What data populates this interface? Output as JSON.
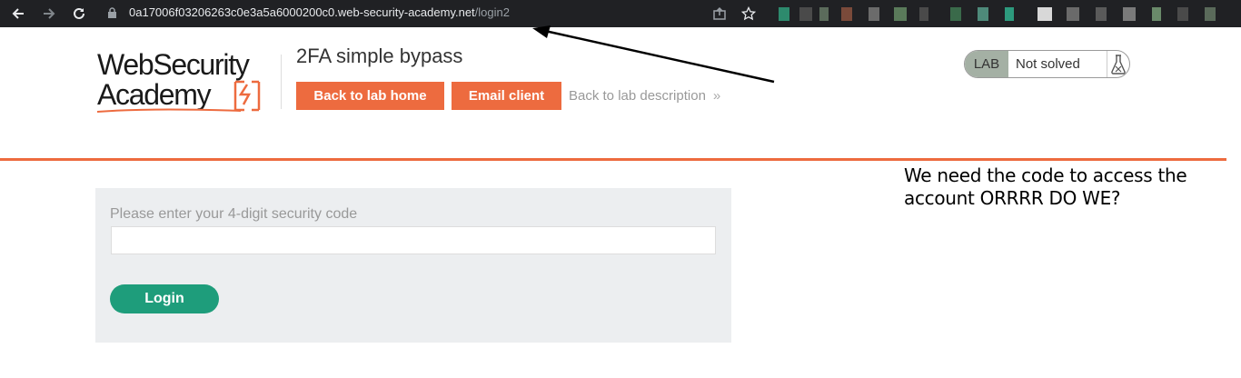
{
  "browser": {
    "url_host": "0a17006f03206263c0e3a5a6000200c0.web-security-academy.net",
    "url_path": "/login2",
    "icons": [
      "back-icon",
      "forward-icon",
      "reload-icon",
      "lock-icon",
      "share-icon",
      "bookmark-star-icon"
    ]
  },
  "header": {
    "logo_line1": "WebSecurity",
    "logo_line2": "Academy",
    "lab_title": "2FA simple bypass",
    "back_home_label": "Back to lab home",
    "email_client_label": "Email client",
    "lab_description_label": "Back to lab description",
    "lab_description_chevron": "»",
    "status_tag": "LAB",
    "status_text": "Not solved"
  },
  "form": {
    "label": "Please enter your 4-digit security code",
    "code_value": "",
    "login_label": "Login"
  },
  "annotation": {
    "text": "We need the code to access the account ORRRR DO WE?"
  },
  "colors": {
    "accent": "#ed6b3f",
    "login_button": "#1e9d7b",
    "form_panel": "#eceef0",
    "browser_bar": "#202124"
  }
}
